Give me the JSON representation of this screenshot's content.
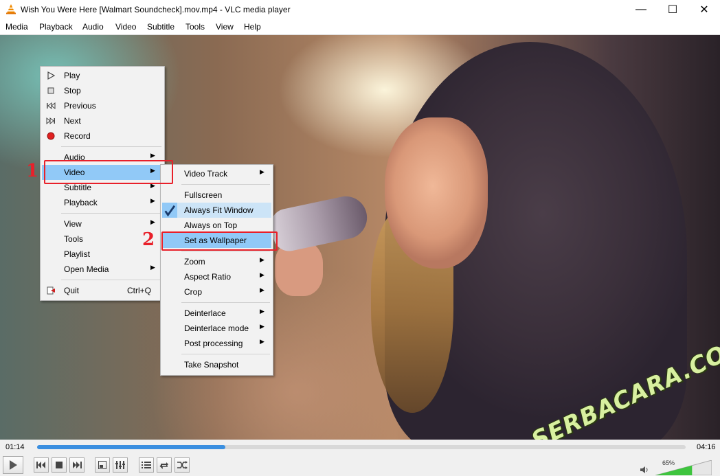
{
  "window": {
    "title": "Wish You Were Here [Walmart Soundcheck].mov.mp4 - VLC media player",
    "minimize": "—",
    "maximize": "☐",
    "close": "✕"
  },
  "menubar": [
    "Media",
    "Playback",
    "Audio",
    "Video",
    "Subtitle",
    "Tools",
    "View",
    "Help"
  ],
  "context_menu": {
    "items": [
      {
        "label": "Play",
        "icon": "play-icon"
      },
      {
        "label": "Stop",
        "icon": "stop-icon"
      },
      {
        "label": "Previous",
        "icon": "previous-icon"
      },
      {
        "label": "Next",
        "icon": "next-icon"
      },
      {
        "label": "Record",
        "icon": "record-icon"
      },
      {
        "label": "Audio",
        "submenu": true
      },
      {
        "label": "Video",
        "submenu": true,
        "highlighted": true
      },
      {
        "label": "Subtitle",
        "submenu": true
      },
      {
        "label": "Playback",
        "submenu": true
      },
      {
        "label": "View",
        "submenu": true
      },
      {
        "label": "Tools"
      },
      {
        "label": "Playlist"
      },
      {
        "label": "Open Media",
        "submenu": true
      },
      {
        "label": "Quit",
        "shortcut": "Ctrl+Q",
        "icon": "quit-icon"
      }
    ]
  },
  "video_submenu": {
    "items": [
      {
        "label": "Video Track",
        "submenu": true
      },
      {
        "label": "Fullscreen"
      },
      {
        "label": "Always Fit Window",
        "checked": true
      },
      {
        "label": "Always on Top"
      },
      {
        "label": "Set as Wallpaper",
        "highlighted": true
      },
      {
        "label": "Zoom",
        "submenu": true
      },
      {
        "label": "Aspect Ratio",
        "submenu": true
      },
      {
        "label": "Crop",
        "submenu": true
      },
      {
        "label": "Deinterlace",
        "submenu": true
      },
      {
        "label": "Deinterlace mode",
        "submenu": true
      },
      {
        "label": "Post processing",
        "submenu": true
      },
      {
        "label": "Take Snapshot"
      }
    ]
  },
  "annotations": {
    "one": "1",
    "two": "2",
    "color": "#e8202a"
  },
  "watermark": "SERBACARA.COM",
  "player": {
    "elapsed": "01:14",
    "total": "04:16",
    "progress_fraction": 0.29,
    "volume": "65%",
    "volume_fraction": 0.65,
    "accent": "#3b8fe0"
  },
  "controls": [
    "play-icon",
    "previous-icon",
    "stop-icon",
    "next-icon",
    "fullscreen-icon",
    "extended-settings-icon",
    "playlist-icon",
    "loop-icon",
    "random-icon"
  ]
}
